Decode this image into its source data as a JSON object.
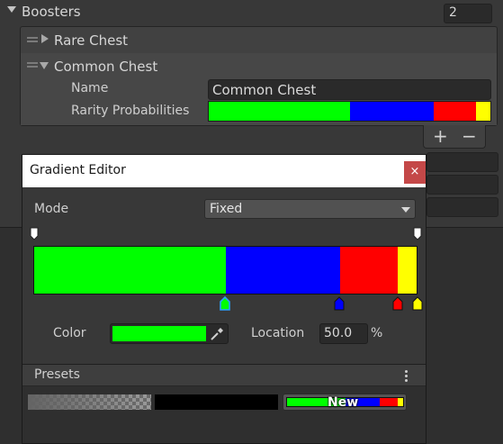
{
  "inspector": {
    "boosters_label": "Boosters",
    "boosters_count": "2",
    "items": [
      {
        "label": "Rare Chest",
        "expanded": false
      },
      {
        "label": "Common Chest",
        "expanded": true
      }
    ],
    "name_label": "Name",
    "name_value": "Common Chest",
    "rarity_label": "Rarity Probabilities",
    "rarity_colors": [
      "#00ff00",
      "#0000ff",
      "#ff0000",
      "#ffff00"
    ],
    "plus_label": "+",
    "minus_label": "−"
  },
  "gradient_editor": {
    "title": "Gradient Editor",
    "close_glyph": "×",
    "mode_label": "Mode",
    "mode_value": "Fixed",
    "gradient": {
      "stops": [
        {
          "color": "#00ff00",
          "location": 50.0
        },
        {
          "color": "#0000ff",
          "location": 80.0
        },
        {
          "color": "#ff0000",
          "location": 95.0
        },
        {
          "color": "#ffff00",
          "location": 100.0
        }
      ],
      "alpha_keys": 2
    },
    "selected_key": "green",
    "color_label": "Color",
    "color_value": "#00ff00",
    "location_label": "Location",
    "location_value": "50.0",
    "percent_label": "%",
    "presets_label": "Presets",
    "presets": [
      {
        "type": "transparent-fade"
      },
      {
        "type": "solid-black"
      },
      {
        "type": "current",
        "label": "New"
      }
    ]
  },
  "colors": {
    "background": "#383838",
    "close_button": "#c44848"
  }
}
